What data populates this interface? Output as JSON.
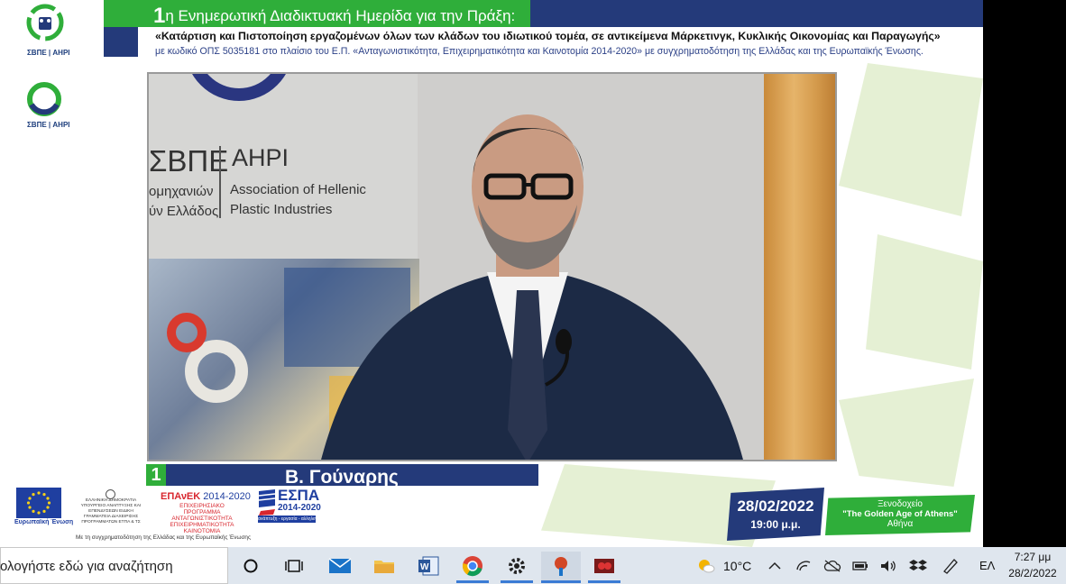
{
  "header": {
    "title_number": "1",
    "title_rest": "η Ενημερωτική Διαδικτυακή Ημερίδα για την Πράξη:",
    "line1": "«Κατάρτιση και Πιστοποίηση εργαζομένων όλων των κλάδων του ιδιωτικού τομέα, σε αντικείμενα Μάρκετινγκ, Κυκλικής Οικονομίας και Παραγωγής»",
    "line2": "με κωδικό ΟΠΣ 5035181 στο πλαίσιο του Ε.Π. «Ανταγωνιστικότητα, Επιχειρηματικότητα και Καινοτομία 2014-2020» με συγχρηματοδότηση της Ελλάδας και της Ευρωπαϊκής Ένωσης."
  },
  "logos": {
    "top": {
      "acronym_gr": "ΣΒΠΕ",
      "acronym_en": "AHPI"
    },
    "second": {
      "acronym_gr": "ΣΒΠΕ",
      "acronym_en": "AHPI"
    }
  },
  "video": {
    "banner_gr": "ΣΒΠΕ",
    "banner_en": "AHPI",
    "banner_sub_gr": "ομηχανιών\nύν Ελλάδος",
    "banner_sub_en": "Association of Hellenic\nPlastic Industries"
  },
  "namebar": {
    "number": "1",
    "name": "Β. Γούναρης"
  },
  "footer": {
    "eu_label": "Ευρωπαϊκή Ένωση",
    "ministry": "ΕΛΛΗΝΙΚΗ ΔΗΜΟΚΡΑΤΙΑ ΥΠΟΥΡΓΕΙΟ ΑΝΑΠΤΥΞΗΣ ΚΑΙ ΕΠΕΝΔΥΣΕΩΝ ΕΙΔΙΚΗ ΓΡΑΜΜΑΤΕΙΑ ΔΙΑΧΕΙΡΙΣΗΣ ΠΡΟΓΡΑΜΜΑΤΩΝ ΕΤΠΑ & ΤΣ",
    "epanek_title": "ΕΠΑνΕΚ",
    "epanek_years": "2014-2020",
    "epanek_sub": "ΕΠΙΧΕΙΡΗΣΙΑΚΟ ΠΡΟΓΡΑΜΜΑ ΑΝΤΑΓΩΝΙΣΤΙΚΟΤΗΤΑ ΕΠΙΧΕΙΡΗΜΑΤΙΚΟΤΗΤΑ ΚΑΙΝΟΤΟΜΙΑ",
    "espa": "ΕΣΠΑ",
    "espa_years": "2014-2020",
    "espa_band": "ανάπτυξη - εργασία - αλληλεγγύη",
    "cofund": "Με τη συγχρηματοδότηση της Ελλάδας και της Ευρωπαϊκής Ένωσης",
    "date": "28/02/2022",
    "time": "19:00 μ.μ.",
    "venue1": "Ξενοδοχείο",
    "venue2": "\"The Golden Age of Athens\"",
    "venue3": "Αθήνα"
  },
  "taskbar": {
    "search_text": "ολογήστε εδώ για αναζήτηση",
    "apps": [
      "cortana-icon",
      "task-view-icon",
      "mail-icon",
      "file-explorer-icon",
      "word-icon",
      "chrome-icon",
      "settings-icon",
      "powerpoint-icon",
      "media-app-icon"
    ],
    "weather": "10°C",
    "language": "ΕΛ",
    "time": "7:27 μμ",
    "date": "28/2/2022"
  },
  "colors": {
    "brand_green": "#2fae3a",
    "brand_navy": "#243a7a",
    "taskbar": "#dfe6ee"
  }
}
